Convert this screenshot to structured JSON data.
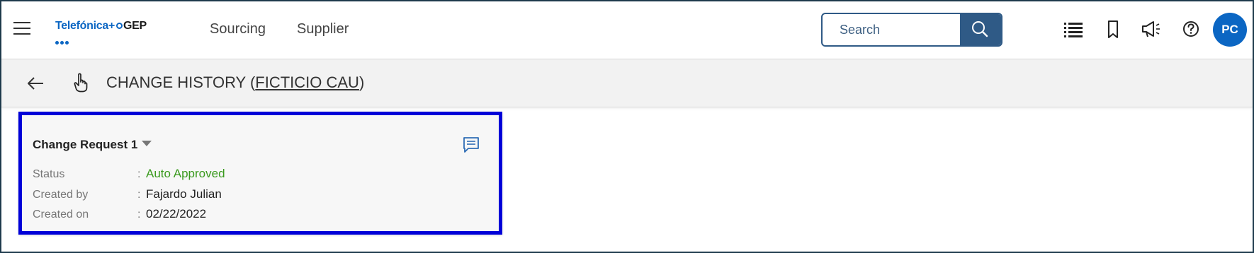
{
  "header": {
    "logo": {
      "brand": "Telefónica",
      "plus": "+",
      "partner": "GEP"
    },
    "nav": [
      {
        "label": "Sourcing"
      },
      {
        "label": "Supplier"
      }
    ],
    "search": {
      "placeholder": "Search",
      "value": ""
    },
    "icons": [
      "menu-icon",
      "list-icon",
      "bookmark-icon",
      "megaphone-icon",
      "help-icon",
      "search-icon"
    ],
    "avatar_initials": "PC",
    "colors": {
      "brand_blue": "#0b66c3",
      "search_button": "#2f5a86"
    }
  },
  "subheader": {
    "title_prefix": "CHANGE HISTORY (",
    "title_link": "FICTICIO CAU",
    "title_suffix": ")"
  },
  "card": {
    "title": "Change Request 1",
    "fields": [
      {
        "label": "Status",
        "value": "Auto Approved",
        "status_color": "#3a9a1e"
      },
      {
        "label": "Created by",
        "value": "Fajardo Julian"
      },
      {
        "label": "Created on",
        "value": "02/22/2022"
      }
    ],
    "separator": ":",
    "highlight_color": "#0000d8"
  }
}
